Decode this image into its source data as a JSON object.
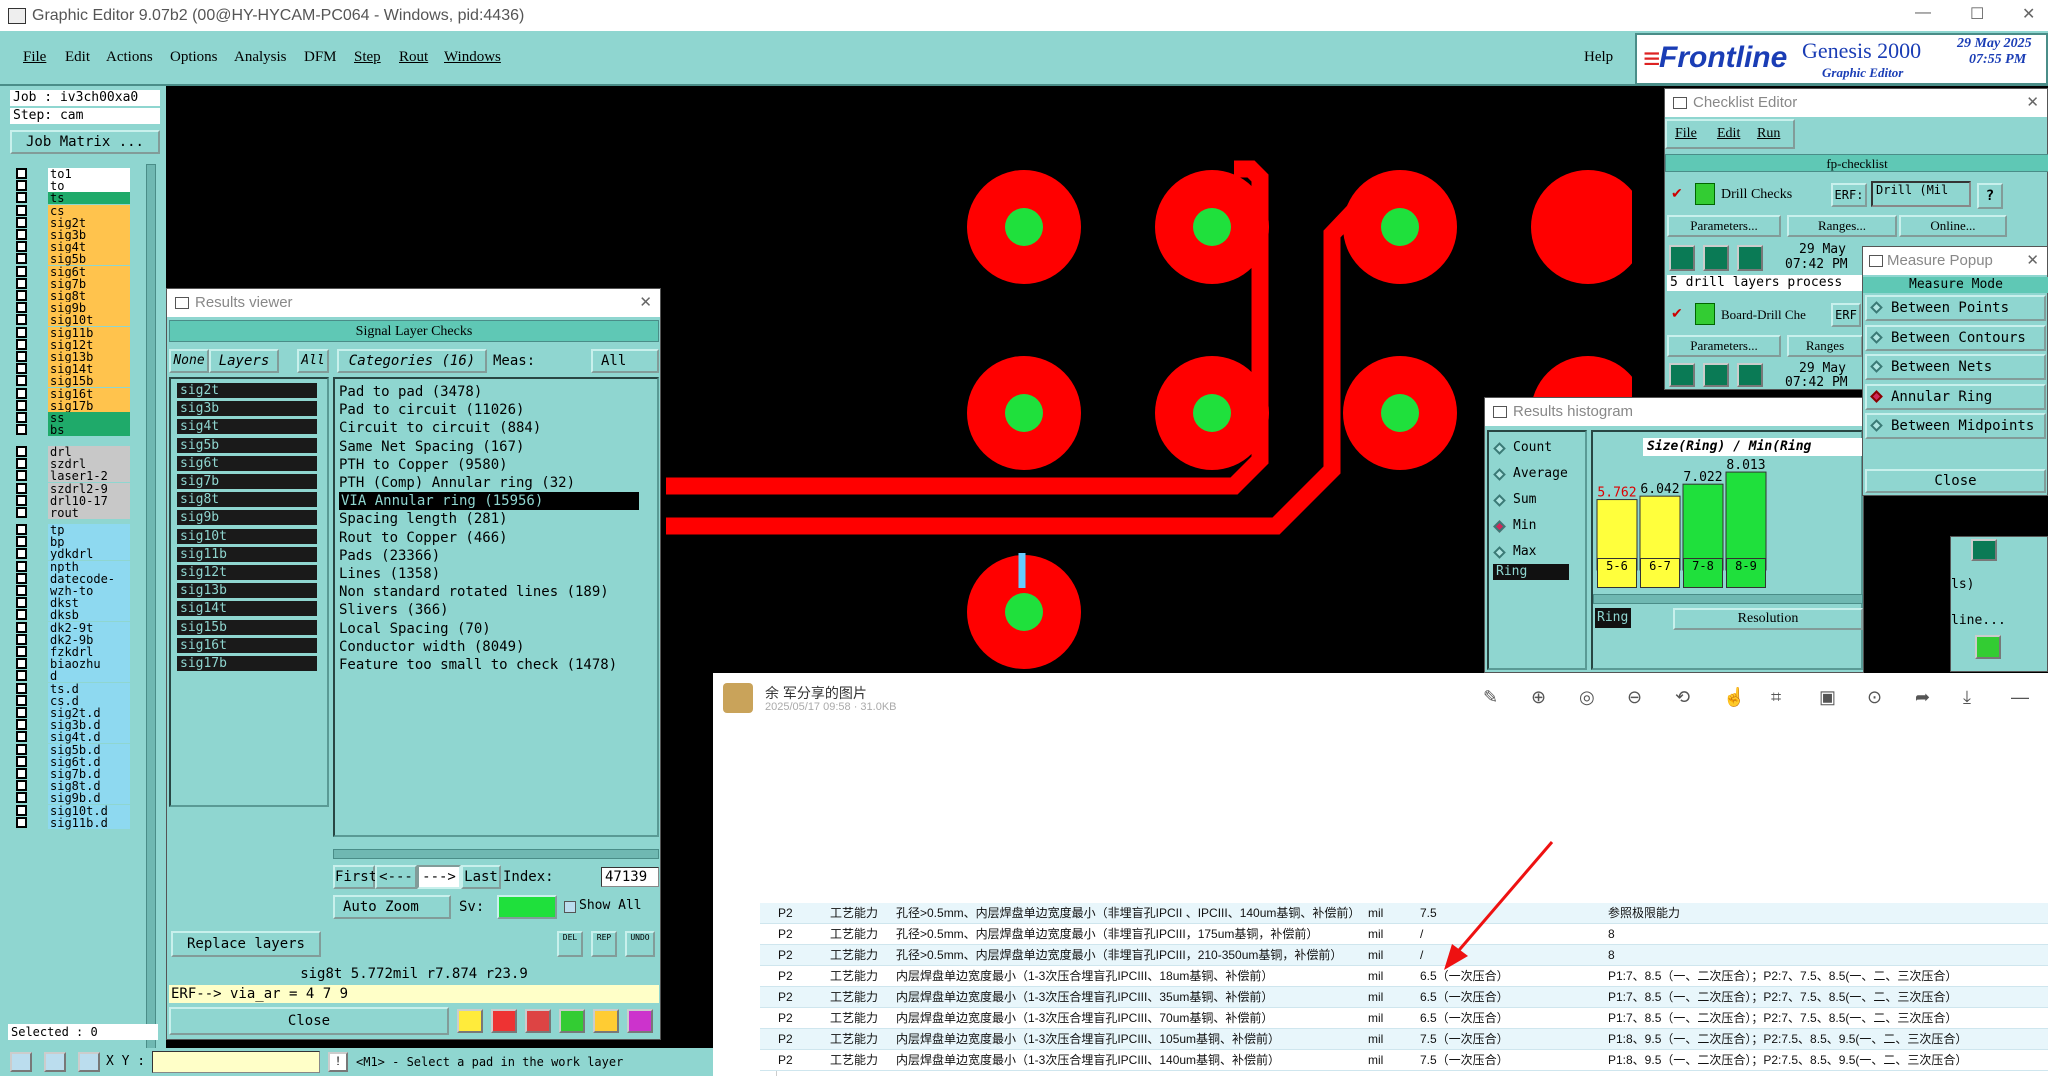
{
  "window_title": "Graphic Editor 9.07b2 (00@HY-HYCAM-PC064 - Windows, pid:4436)",
  "menu": [
    "File",
    "Edit",
    "Actions",
    "Options",
    "Analysis",
    "DFM",
    "Step",
    "Rout",
    "Windows"
  ],
  "help": "Help",
  "logo": {
    "brand": "Frontline",
    "product": "Genesis 2000",
    "sub": "Graphic Editor",
    "date": "29 May 2025",
    "time": "07:55 PM"
  },
  "left": {
    "job": "Job : iv3ch00xa0",
    "step": "Step: cam",
    "job_matrix": "Job Matrix ...",
    "layers1": [
      "to1",
      "to",
      "ts",
      "cs",
      "sig2t",
      "sig3b",
      "sig4t",
      "sig5b",
      "sig6t",
      "sig7b",
      "sig8t",
      "sig9b",
      "sig10t",
      "sig11b",
      "sig12t",
      "sig13b",
      "sig14t",
      "sig15b",
      "sig16t",
      "sig17b",
      "ss",
      "bs"
    ],
    "layers2": [
      "drl",
      "szdrl",
      "laser1-2",
      "szdrl2-9",
      "drl10-17",
      "rout"
    ],
    "layers3": [
      "tp",
      "bp",
      "ydkdrl",
      "npth",
      "datecode-pte",
      "wzh-to",
      "dkst",
      "dksb",
      "dk2-9t",
      "dk2-9b",
      "fzkdrl",
      "biaozhu",
      "d",
      "ts.d",
      "cs.d",
      "sig2t.d",
      "sig3b.d",
      "sig4t.d",
      "sig5b.d",
      "sig6t.d",
      "sig7b.d",
      "sig8t.d",
      "sig9b.d",
      "sig10t.d",
      "sig11b.d"
    ],
    "selected": "Selected : 0",
    "xy_label": "X Y :",
    "status": "<M1> - Select a pad in the work layer"
  },
  "results_viewer": {
    "title": "Results viewer",
    "header": "Signal Layer Checks",
    "none": "None",
    "layers": "Layers",
    "all": "All",
    "categories": "Categories (16)",
    "meas": "Meas:",
    "meas_val": "All",
    "layer_list": [
      "sig2t",
      "sig3b",
      "sig4t",
      "sig5b",
      "sig6t",
      "sig7b",
      "sig8t",
      "sig9b",
      "sig10t",
      "sig11b",
      "sig12t",
      "sig13b",
      "sig14t",
      "sig15b",
      "sig16t",
      "sig17b"
    ],
    "cat_list": [
      "Pad to pad (3478)",
      "Pad to circuit (11026)",
      "Circuit to circuit (884)",
      "Same Net Spacing (167)",
      "PTH to Copper (9580)",
      "PTH (Comp) Annular ring (32)",
      "VIA Annular ring (15956)",
      "Spacing length (281)",
      "Rout to Copper (466)",
      "Pads (23366)",
      "Lines (1358)",
      "Non standard rotated lines (189)",
      "Slivers (366)",
      "Local Spacing (70)",
      "Conductor width (8049)",
      "Feature too small to check (1478)"
    ],
    "selected_cat": 6,
    "first": "First",
    "prev": "<---",
    "next": "--->",
    "last": "Last",
    "index_label": "Index:",
    "index_val": "47139",
    "auto_zoom": "Auto Zoom",
    "sv": "Sv:",
    "show_all": "Show All",
    "replace_layers": "Replace layers",
    "del": "DEL",
    "rep": "REP",
    "undo": "UNDO",
    "info": "sig8t 5.772mil  r7.874  r23.9",
    "erf": "ERF--> via_ar = 4 7 9",
    "close": "Close"
  },
  "checklist": {
    "title": "Checklist Editor",
    "menu": [
      "File",
      "Edit",
      "Run"
    ],
    "name": "fp-checklist",
    "drill_checks": "Drill Checks",
    "erf": "ERF:",
    "erf_val": "Drill (Mil",
    "params": "Parameters...",
    "ranges": "Ranges...",
    "online": "Online...",
    "date": "29 May",
    "time": "07:42 PM",
    "process": "5 drill layers process",
    "board_drill": "Board-Drill Che",
    "erf2": "ERF",
    "ranges2": "Ranges",
    "date2": "29 May",
    "time2": "07:42 PM"
  },
  "measure_popup": {
    "title": "Measure Popup",
    "mode": "Measure Mode",
    "items": [
      "Between Points",
      "Between Contours",
      "Between Nets",
      "Annular Ring",
      "Between Midpoints"
    ],
    "active": 3,
    "close": "Close"
  },
  "histogram": {
    "title": "Results histogram",
    "stats": [
      "Count",
      "Average",
      "Sum",
      "Min",
      "Max"
    ],
    "active_stat": 3,
    "ring": "Ring",
    "header": "Size(Ring) / Min(Ring",
    "bins": [
      "5-6",
      "6-7",
      "7-8",
      "8-9"
    ],
    "values": [
      5.762,
      6.042,
      7.022,
      8.013
    ],
    "value_labels": [
      "5.762",
      "6.042",
      "7.022",
      "8.013"
    ],
    "colors": [
      "#ffff3c",
      "#ffff3c",
      "#1fe03c",
      "#1fe03c"
    ],
    "resolution": "Resolution",
    "ring2": "Ring",
    "peek1": "ls)",
    "peek2": "line..."
  },
  "image_viewer": {
    "sender": "余 军分享的图片",
    "meta": "2025/05/17 09:58 · 31.0KB",
    "rows": [
      [
        "P2",
        "工艺能力",
        "孔径>0.5mm、内层焊盘单边宽度最小（非埋盲孔IPCII 、IPCIII、140um基铜、补偿前）",
        "mil",
        "7.5",
        "参照极限能力"
      ],
      [
        "P2",
        "工艺能力",
        "孔径>0.5mm、内层焊盘单边宽度最小（非埋盲孔IPCIII，175um基铜，补偿前）",
        "mil",
        "/",
        "8"
      ],
      [
        "P2",
        "工艺能力",
        "孔径>0.5mm、内层焊盘单边宽度最小（非埋盲孔IPCIII，210-350um基铜，补偿前）",
        "mil",
        "/",
        "8"
      ],
      [
        "P2",
        "工艺能力",
        "内层焊盘单边宽度最小（1-3次压合埋盲孔IPCIII、18um基铜、补偿前）",
        "mil",
        "6.5（一次压合）",
        "P1:7、8.5（一、二次压合）；P2:7、7.5、8.5(一、二、三次压合）"
      ],
      [
        "P2",
        "工艺能力",
        "内层焊盘单边宽度最小（1-3次压合埋盲孔IPCIII、35um基铜、补偿前）",
        "mil",
        "6.5（一次压合）",
        "P1:7、8.5（一、二次压合）；P2:7、7.5、8.5(一、二、三次压合）"
      ],
      [
        "P2",
        "工艺能力",
        "内层焊盘单边宽度最小（1-3次压合埋盲孔IPCIII、70um基铜、补偿前）",
        "mil",
        "6.5（一次压合）",
        "P1:7、8.5（一、二次压合）；P2:7、7.5、8.5(一、二、三次压合）"
      ],
      [
        "P2",
        "工艺能力",
        "内层焊盘单边宽度最小（1-3次压合埋盲孔IPCIII、105um基铜、补偿前）",
        "mil",
        "7.5（一次压合）",
        "P1:8、9.5（一、二次压合）；P2:7.5、8.5、9.5(一、二、三次压合）"
      ],
      [
        "P2",
        "工艺能力",
        "内层焊盘单边宽度最小（1-3次压合埋盲孔IPCIII、140um基铜、补偿前）",
        "mil",
        "7.5（一次压合）",
        "P1:8、9.5（一、二次压合）；P2:7.5、8.5、9.5(一、二、三次压合）"
      ]
    ]
  }
}
